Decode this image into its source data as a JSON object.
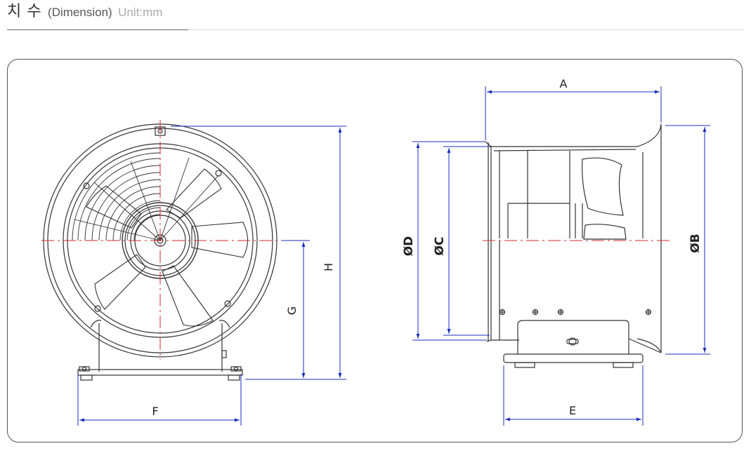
{
  "header": {
    "title_ko": "치 수",
    "title_en": "(Dimension)",
    "unit": "Unit:mm"
  },
  "drawing": {
    "labels": {
      "A": "A",
      "B": "ØB",
      "C": "ØC",
      "D": "ØD",
      "E": "E",
      "F": "F",
      "G": "G",
      "H": "H"
    }
  },
  "colors": {
    "dimension_line": "#1a2fbf",
    "center_line": "#d62828",
    "outline": "#333333"
  }
}
